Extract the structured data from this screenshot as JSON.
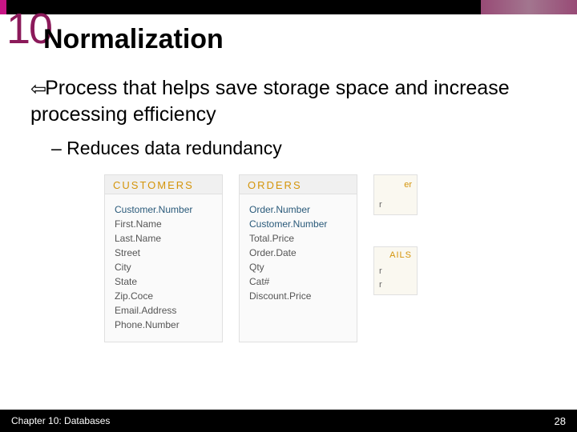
{
  "chapterNumber": "10",
  "title": "Normalization",
  "mainText": "Process that helps save storage space and increase processing efficiency",
  "subText": "– Reduces data redundancy",
  "tables": {
    "customers": {
      "header": "CUSTOMERS",
      "fields": [
        "Customer.Number",
        "First.Name",
        "Last.Name",
        "Street",
        "City",
        "State",
        "Zip.Coce",
        "Email.Address",
        "Phone.Number"
      ]
    },
    "orders": {
      "header": "ORDERS",
      "fields": [
        "Order.Number",
        "Customer.Number",
        "Total.Price",
        "Order.Date",
        "Qty",
        "Cat#",
        "Discount.Price"
      ]
    }
  },
  "phantom": {
    "top": {
      "suffix": "er",
      "field": "r"
    },
    "bottom": {
      "suffix": "AILS",
      "fields": [
        "r",
        "r"
      ]
    }
  },
  "footer": {
    "left": "Chapter 10: Databases",
    "right": "28"
  }
}
